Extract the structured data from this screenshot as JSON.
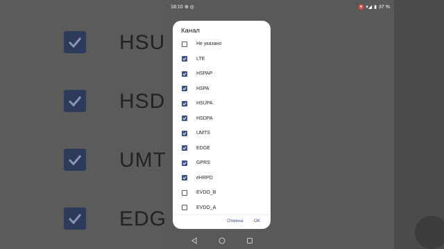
{
  "background": {
    "rows": [
      "HSUP",
      "HSDP",
      "UMTS",
      "EDGE"
    ]
  },
  "statusbar": {
    "time": "18:10",
    "battery": "37 %"
  },
  "dialog": {
    "title": "Канал",
    "items": [
      {
        "label": "Не указано",
        "checked": false
      },
      {
        "label": "LTE",
        "checked": true
      },
      {
        "label": "HSPAP",
        "checked": true
      },
      {
        "label": "HSPA",
        "checked": true
      },
      {
        "label": "HSUPA",
        "checked": true
      },
      {
        "label": "HSDPA",
        "checked": true
      },
      {
        "label": "UMTS",
        "checked": true
      },
      {
        "label": "EDGE",
        "checked": true
      },
      {
        "label": "GPRS",
        "checked": true
      },
      {
        "label": "eHRPD",
        "checked": true
      },
      {
        "label": "EVDO_B",
        "checked": false
      },
      {
        "label": "EVDO_A",
        "checked": false
      }
    ],
    "cancel_label": "Отмена",
    "ok_label": "ОК"
  },
  "colors": {
    "accent": "#3d5486",
    "dialog_bg": "#ffffff",
    "scrim": "#595959"
  }
}
